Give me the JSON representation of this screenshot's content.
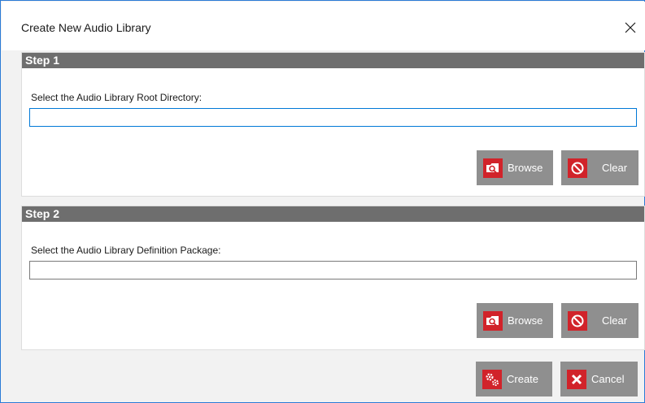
{
  "dialog": {
    "title": "Create New Audio Library",
    "close_icon": "close-icon"
  },
  "step1": {
    "header": "Step 1",
    "label": "Select the Audio Library Root Directory:",
    "input_value": "",
    "browse_label": "Browse",
    "clear_label": "Clear"
  },
  "step2": {
    "header": "Step 2",
    "label": "Select the Audio Library Definition Package:",
    "input_value": "",
    "browse_label": "Browse",
    "clear_label": "Clear"
  },
  "footer": {
    "create_label": "Create",
    "cancel_label": "Cancel"
  },
  "colors": {
    "accent": "#d1232a",
    "header_bg": "#6e6e6e",
    "button_bg": "#8f8f8f",
    "focus_border": "#0078d7"
  }
}
